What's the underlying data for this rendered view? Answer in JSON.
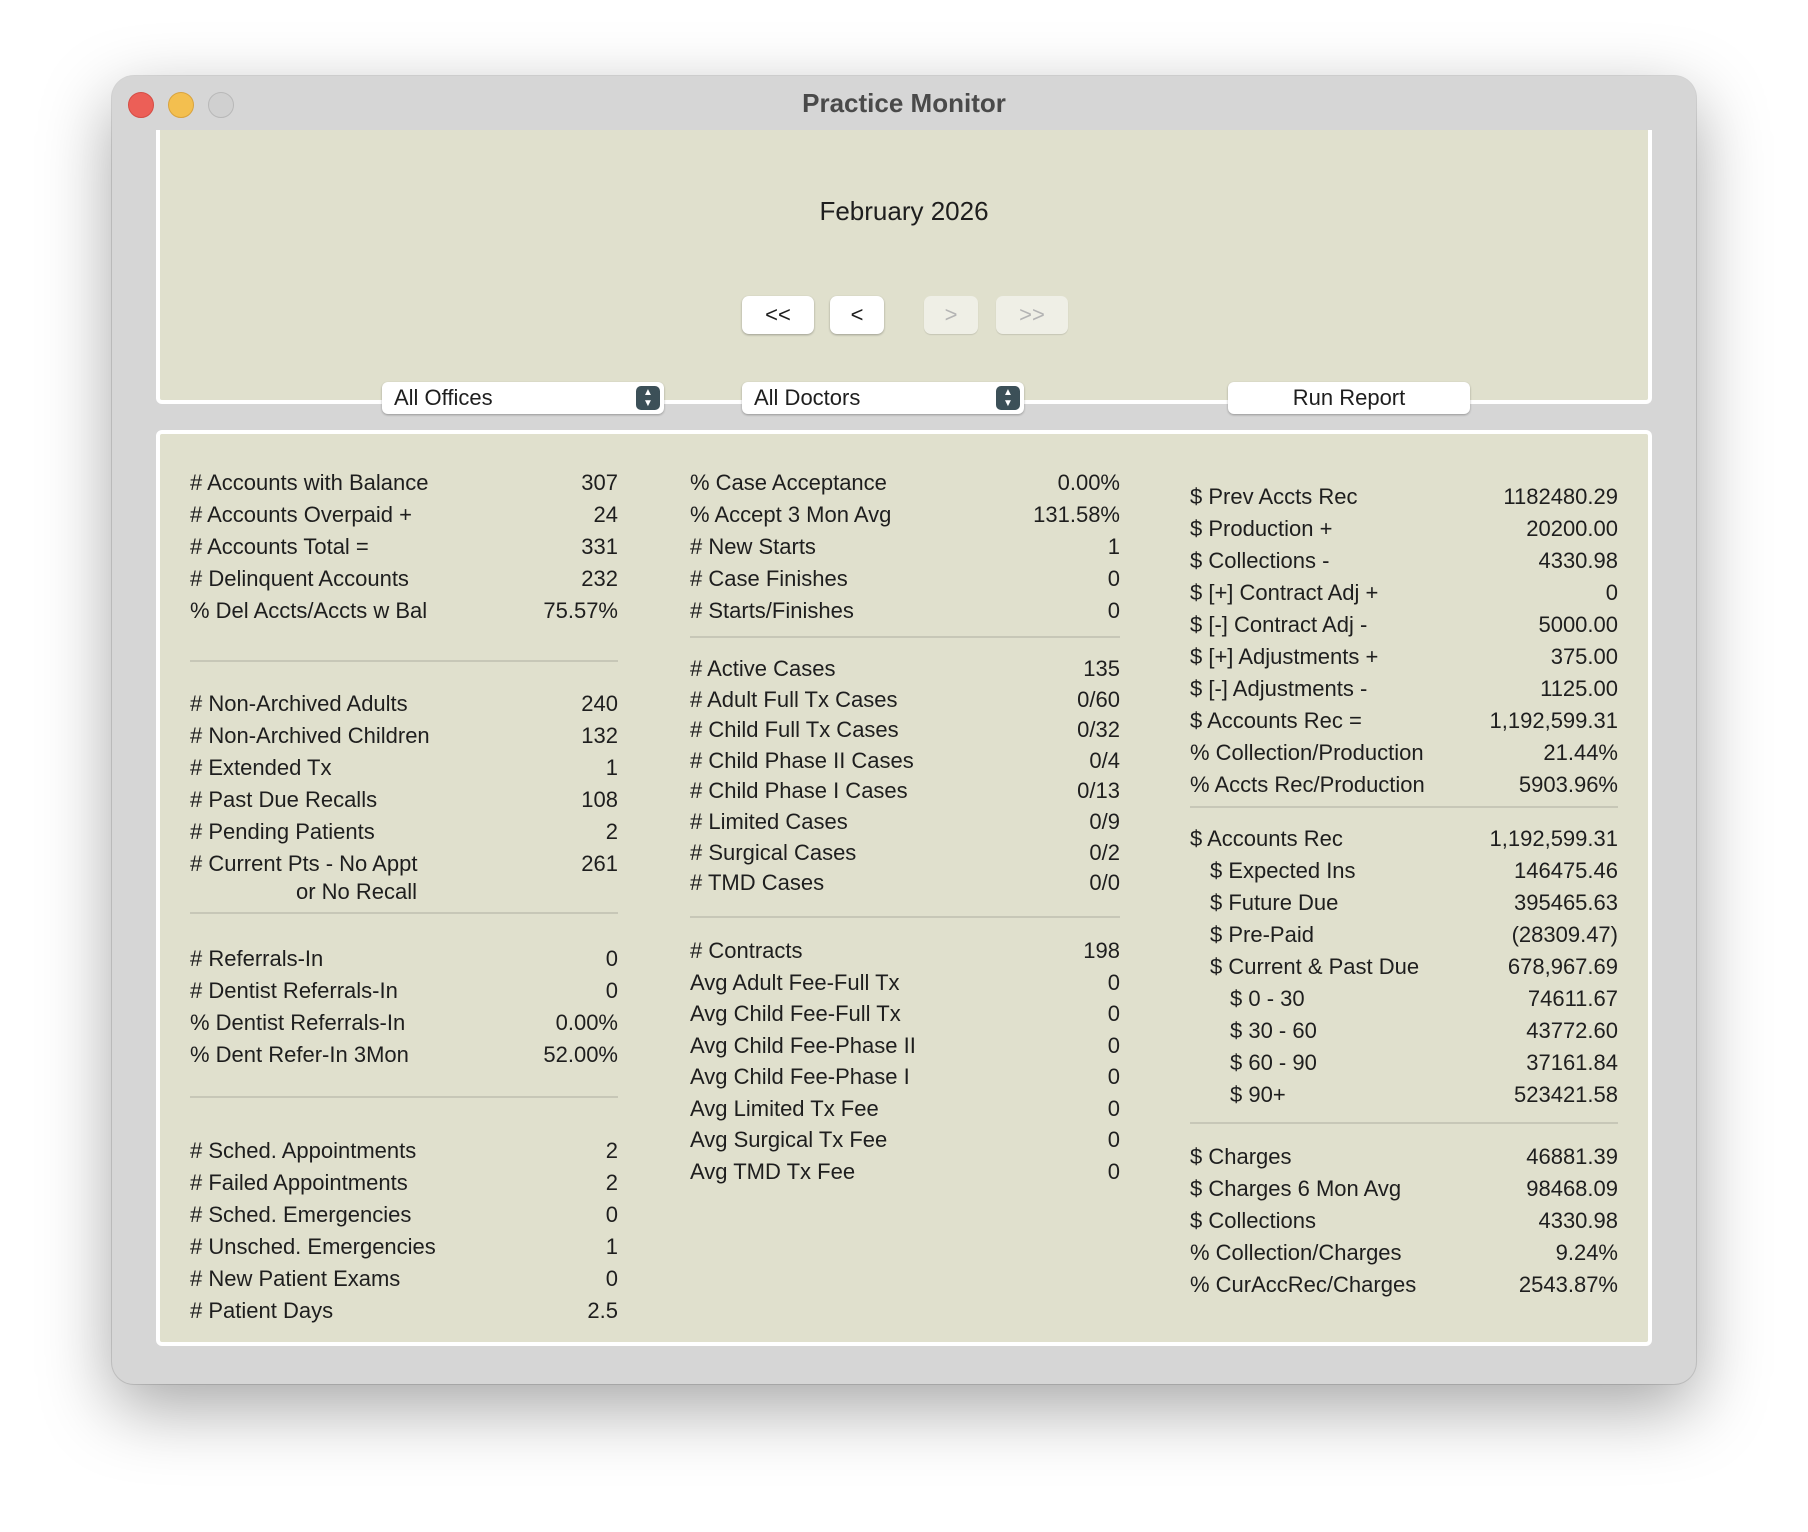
{
  "window": {
    "title": "Practice Monitor"
  },
  "header": {
    "month": "February 2026",
    "nav": {
      "first": "<<",
      "prev": "<",
      "next": ">",
      "last": ">>"
    },
    "office_select": "All Offices",
    "doctor_select": "All Doctors",
    "run_report": "Run Report"
  },
  "col1": {
    "accounts": [
      {
        "label": "# Accounts with Balance",
        "value": "307"
      },
      {
        "label": "# Accounts Overpaid +",
        "value": "24"
      },
      {
        "label": "# Accounts Total =",
        "value": "331"
      },
      {
        "label": "# Delinquent Accounts",
        "value": "232"
      },
      {
        "label": "% Del Accts/Accts w Bal",
        "value": "75.57%"
      }
    ],
    "patients": [
      {
        "label": "# Non-Archived Adults",
        "value": "240"
      },
      {
        "label": "# Non-Archived Children",
        "value": "132"
      },
      {
        "label": "# Extended Tx",
        "value": "1"
      },
      {
        "label": "# Past Due Recalls",
        "value": "108"
      },
      {
        "label": "# Pending Patients",
        "value": "2"
      },
      {
        "label": "# Current Pts - No Appt",
        "value": "261"
      }
    ],
    "patients_cont": "or No Recall",
    "referrals": [
      {
        "label": "# Referrals-In",
        "value": "0"
      },
      {
        "label": "# Dentist Referrals-In",
        "value": "0"
      },
      {
        "label": "% Dentist Referrals-In",
        "value": "0.00%"
      },
      {
        "label": "% Dent Refer-In 3Mon",
        "value": "52.00%"
      }
    ],
    "appointments": [
      {
        "label": "# Sched. Appointments",
        "value": "2"
      },
      {
        "label": "# Failed Appointments",
        "value": "2"
      },
      {
        "label": "# Sched. Emergencies",
        "value": "0"
      },
      {
        "label": "# Unsched. Emergencies",
        "value": "1"
      },
      {
        "label": "# New Patient Exams",
        "value": "0"
      },
      {
        "label": "# Patient Days",
        "value": "2.5"
      }
    ]
  },
  "col2": {
    "acceptance": [
      {
        "label": "% Case Acceptance",
        "value": "0.00%"
      },
      {
        "label": "% Accept 3 Mon Avg",
        "value": "131.58%"
      },
      {
        "label": "# New Starts",
        "value": "1"
      },
      {
        "label": "# Case Finishes",
        "value": "0"
      },
      {
        "label": "# Starts/Finishes",
        "value": "0"
      }
    ],
    "cases": [
      {
        "label": "# Active Cases",
        "value": "135"
      },
      {
        "label": "# Adult Full Tx Cases",
        "value": "0/60"
      },
      {
        "label": "# Child Full Tx Cases",
        "value": "0/32"
      },
      {
        "label": "# Child Phase II Cases",
        "value": "0/4"
      },
      {
        "label": "# Child Phase I Cases",
        "value": "0/13"
      },
      {
        "label": "# Limited Cases",
        "value": "0/9"
      },
      {
        "label": "# Surgical Cases",
        "value": "0/2"
      },
      {
        "label": "# TMD Cases",
        "value": "0/0"
      }
    ],
    "contracts": [
      {
        "label": "# Contracts",
        "value": "198"
      },
      {
        "label": "Avg Adult Fee-Full Tx",
        "value": "0"
      },
      {
        "label": "Avg Child Fee-Full Tx",
        "value": "0"
      },
      {
        "label": "Avg Child Fee-Phase II",
        "value": "0"
      },
      {
        "label": "Avg Child Fee-Phase I",
        "value": "0"
      },
      {
        "label": "Avg Limited Tx Fee",
        "value": "0"
      },
      {
        "label": "Avg Surgical Tx Fee",
        "value": "0"
      },
      {
        "label": "Avg TMD Tx Fee",
        "value": "0"
      }
    ]
  },
  "col3": {
    "receivables": [
      {
        "label": "$ Prev Accts Rec",
        "value": "1182480.29"
      },
      {
        "label": "$ Production +",
        "value": "20200.00"
      },
      {
        "label": "$ Collections -",
        "value": "4330.98"
      },
      {
        "label": "$ [+] Contract Adj +",
        "value": "0"
      },
      {
        "label": "$ [-] Contract Adj -",
        "value": "5000.00"
      },
      {
        "label": "$ [+] Adjustments +",
        "value": "375.00"
      },
      {
        "label": "$ [-] Adjustments -",
        "value": "1125.00"
      },
      {
        "label": "$ Accounts Rec =",
        "value": "1,192,599.31"
      },
      {
        "label": "% Collection/Production",
        "value": "21.44%"
      },
      {
        "label": "% Accts Rec/Production",
        "value": "5903.96%"
      }
    ],
    "aging": [
      {
        "label": "$ Accounts Rec",
        "value": "1,192,599.31"
      },
      {
        "label": "$ Expected Ins",
        "value": "146475.46"
      },
      {
        "label": "$ Future Due",
        "value": "395465.63"
      },
      {
        "label": "$ Pre-Paid",
        "value": "(28309.47)"
      },
      {
        "label": "$ Current & Past Due",
        "value": "678,967.69"
      },
      {
        "label": "$ 0 - 30",
        "value": "74611.67"
      },
      {
        "label": "$ 30 - 60",
        "value": "43772.60"
      },
      {
        "label": "$ 60 - 90",
        "value": "37161.84"
      },
      {
        "label": "$ 90+",
        "value": "523421.58"
      }
    ],
    "charges": [
      {
        "label": "$ Charges",
        "value": "46881.39"
      },
      {
        "label": "$ Charges 6 Mon Avg",
        "value": "98468.09"
      },
      {
        "label": "$ Collections",
        "value": "4330.98"
      },
      {
        "label": "% Collection/Charges",
        "value": "9.24%"
      },
      {
        "label": "% CurAccRec/Charges",
        "value": "2543.87%"
      }
    ]
  }
}
